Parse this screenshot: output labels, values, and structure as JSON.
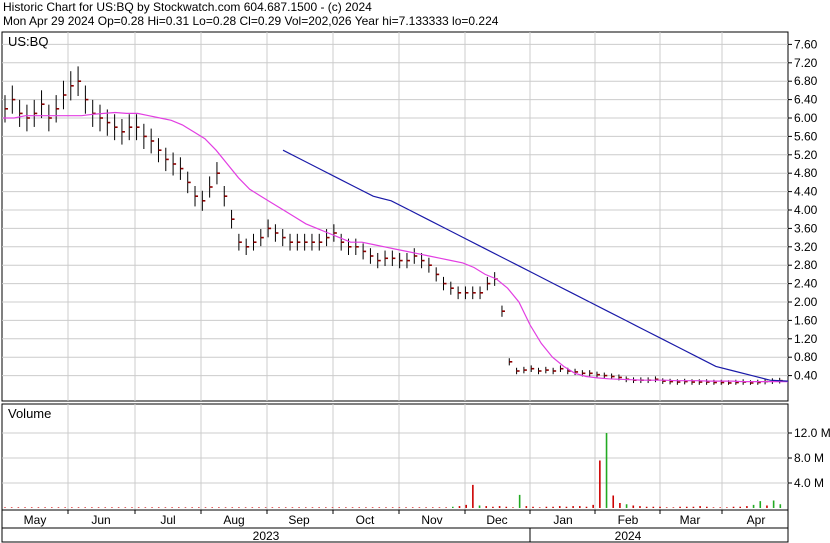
{
  "header": {
    "line1": "Historic Chart for US:BQ by Stockwatch.com 604.687.1500 - (c) 2024",
    "line2": "Mon Apr 29 2024  Op=0.28  Hi=0.31  Lo=0.28  Cl=0.29  Vol=202,026  Year hi=7.133333  lo=0.224"
  },
  "chart_data": [
    {
      "type": "line",
      "title": "US:BQ",
      "ylim": [
        0,
        7.8
      ],
      "yticks": [
        "0.40",
        "0.80",
        "1.20",
        "1.60",
        "2.00",
        "2.40",
        "2.80",
        "3.20",
        "3.60",
        "4.00",
        "4.40",
        "4.80",
        "5.20",
        "5.60",
        "6.00",
        "6.40",
        "6.80",
        "7.20",
        "7.60"
      ],
      "x_month_labels": [
        "May",
        "Jun",
        "Jul",
        "Aug",
        "Sep",
        "Oct",
        "Nov",
        "Dec",
        "Jan",
        "Feb",
        "Mar",
        "Apr"
      ],
      "x_year_labels": [
        "2023",
        "2024"
      ],
      "colors": {
        "price": "#8b0000",
        "ma_short": "#e23ee2",
        "ma_long": "#1a1aa8",
        "grid": "#cccccc"
      },
      "series": [
        {
          "kind": "price_close",
          "values": [
            6.2,
            6.4,
            6.1,
            6.0,
            6.1,
            6.3,
            6.0,
            6.2,
            6.5,
            6.7,
            6.8,
            6.4,
            6.1,
            6.0,
            5.9,
            5.8,
            5.7,
            5.8,
            5.8,
            5.6,
            5.5,
            5.3,
            5.1,
            5.0,
            4.9,
            4.6,
            4.3,
            4.2,
            4.5,
            4.8,
            4.3,
            3.8,
            3.3,
            3.2,
            3.3,
            3.4,
            3.6,
            3.5,
            3.4,
            3.3,
            3.3,
            3.3,
            3.3,
            3.3,
            3.4,
            3.5,
            3.3,
            3.2,
            3.2,
            3.1,
            3.0,
            2.9,
            2.95,
            2.95,
            2.9,
            2.9,
            3.0,
            2.9,
            2.8,
            2.6,
            2.4,
            2.3,
            2.2,
            2.2,
            2.2,
            2.2,
            2.4,
            2.5,
            1.8,
            0.7,
            0.5,
            0.52,
            0.55,
            0.5,
            0.52,
            0.5,
            0.55,
            0.5,
            0.48,
            0.45,
            0.45,
            0.42,
            0.4,
            0.38,
            0.36,
            0.32,
            0.3,
            0.3,
            0.3,
            0.32,
            0.28,
            0.27,
            0.26,
            0.27,
            0.26,
            0.26,
            0.26,
            0.25,
            0.25,
            0.24,
            0.25,
            0.26,
            0.24,
            0.25,
            0.27,
            0.28,
            0.29
          ]
        },
        {
          "kind": "ma_short",
          "values": [
            6.0,
            6.0,
            6.05,
            6.05,
            6.05,
            6.05,
            6.05,
            6.05,
            6.08,
            6.1,
            6.12,
            6.1,
            6.1,
            6.05,
            6.0,
            5.95,
            5.85,
            5.7,
            5.55,
            5.3,
            5.0,
            4.7,
            4.45,
            4.3,
            4.15,
            4.0,
            3.85,
            3.7,
            3.6,
            3.5,
            3.4,
            3.3,
            3.3,
            3.25,
            3.2,
            3.15,
            3.1,
            3.05,
            3.0,
            2.95,
            2.9,
            2.85,
            2.75,
            2.6,
            2.5,
            2.3,
            2.0,
            1.5,
            1.1,
            0.8,
            0.6,
            0.45,
            0.38,
            0.35,
            0.33,
            0.32,
            0.31,
            0.3,
            0.3,
            0.3,
            0.29,
            0.29,
            0.29,
            0.28,
            0.28,
            0.28,
            0.27,
            0.27,
            0.27,
            0.27,
            0.27
          ]
        },
        {
          "kind": "ma_long",
          "values": [
            5.3,
            5.1,
            4.9,
            4.7,
            4.5,
            4.3,
            4.2,
            4.0,
            3.8,
            3.6,
            3.4,
            3.2,
            3.0,
            2.8,
            2.6,
            2.4,
            2.2,
            2.0,
            1.8,
            1.6,
            1.4,
            1.2,
            1.0,
            0.8,
            0.6,
            0.5,
            0.4,
            0.3,
            0.28
          ]
        }
      ]
    },
    {
      "type": "bar",
      "title": "Volume",
      "ylim": [
        0,
        14
      ],
      "yticks": [
        "4.0 M",
        "8.0 M",
        "12.0 M"
      ],
      "colors": {
        "up": "#22aa22",
        "down": "#cc0000"
      },
      "values": [
        0.1,
        0.1,
        0.1,
        0.1,
        0.1,
        0.1,
        0.1,
        0.1,
        0.1,
        0.1,
        0.1,
        0.1,
        0.1,
        0.1,
        0.1,
        0.1,
        0.1,
        0.1,
        0.1,
        0.1,
        0.1,
        0.1,
        0.1,
        0.1,
        0.1,
        0.1,
        0.1,
        0.1,
        0.1,
        0.1,
        0.1,
        0.1,
        0.1,
        0.1,
        0.1,
        0.1,
        0.1,
        0.1,
        0.1,
        0.1,
        0.1,
        0.1,
        0.1,
        0.1,
        0.1,
        0.1,
        0.1,
        0.1,
        0.1,
        0.1,
        0.1,
        0.1,
        0.1,
        0.1,
        0.1,
        0.1,
        0.1,
        0.1,
        0.1,
        0.1,
        0.1,
        0.1,
        0.1,
        0.1,
        0.1,
        0.1,
        0.1,
        0.2,
        0.3,
        0.5,
        3.7,
        0.4,
        0.3,
        0.2,
        0.3,
        0.2,
        0.1,
        2.1,
        0.3,
        0.2,
        0.1,
        0.2,
        0.2,
        0.3,
        0.2,
        0.3,
        0.3,
        0.2,
        0.5,
        7.6,
        12.0,
        2.0,
        0.8,
        0.6,
        0.4,
        0.3,
        0.2,
        0.2,
        0.2,
        0.1,
        0.1,
        0.2,
        0.2,
        0.2,
        0.3,
        0.2,
        0.1,
        0.1,
        0.1,
        0.2,
        0.2,
        0.3,
        0.5,
        1.1,
        0.4,
        1.2,
        0.6
      ],
      "up": [
        0,
        0,
        0,
        0,
        0,
        0,
        0,
        0,
        0,
        0,
        0,
        0,
        0,
        0,
        0,
        0,
        0,
        0,
        0,
        0,
        0,
        0,
        0,
        0,
        0,
        0,
        0,
        0,
        0,
        0,
        0,
        0,
        0,
        0,
        0,
        0,
        0,
        0,
        0,
        0,
        0,
        0,
        0,
        0,
        0,
        0,
        0,
        0,
        0,
        0,
        0,
        0,
        0,
        0,
        0,
        0,
        0,
        0,
        0,
        0,
        0,
        0,
        0,
        0,
        0,
        0,
        0,
        1,
        0,
        0,
        0,
        1,
        0,
        0,
        0,
        0,
        0,
        1,
        0,
        0,
        0,
        0,
        0,
        0,
        0,
        0,
        0,
        0,
        0,
        0,
        1,
        0,
        0,
        1,
        0,
        0,
        0,
        0,
        0,
        0,
        0,
        0,
        0,
        0,
        0,
        0,
        0,
        0,
        0,
        0,
        0,
        0,
        1,
        1,
        0,
        1,
        1
      ]
    }
  ]
}
